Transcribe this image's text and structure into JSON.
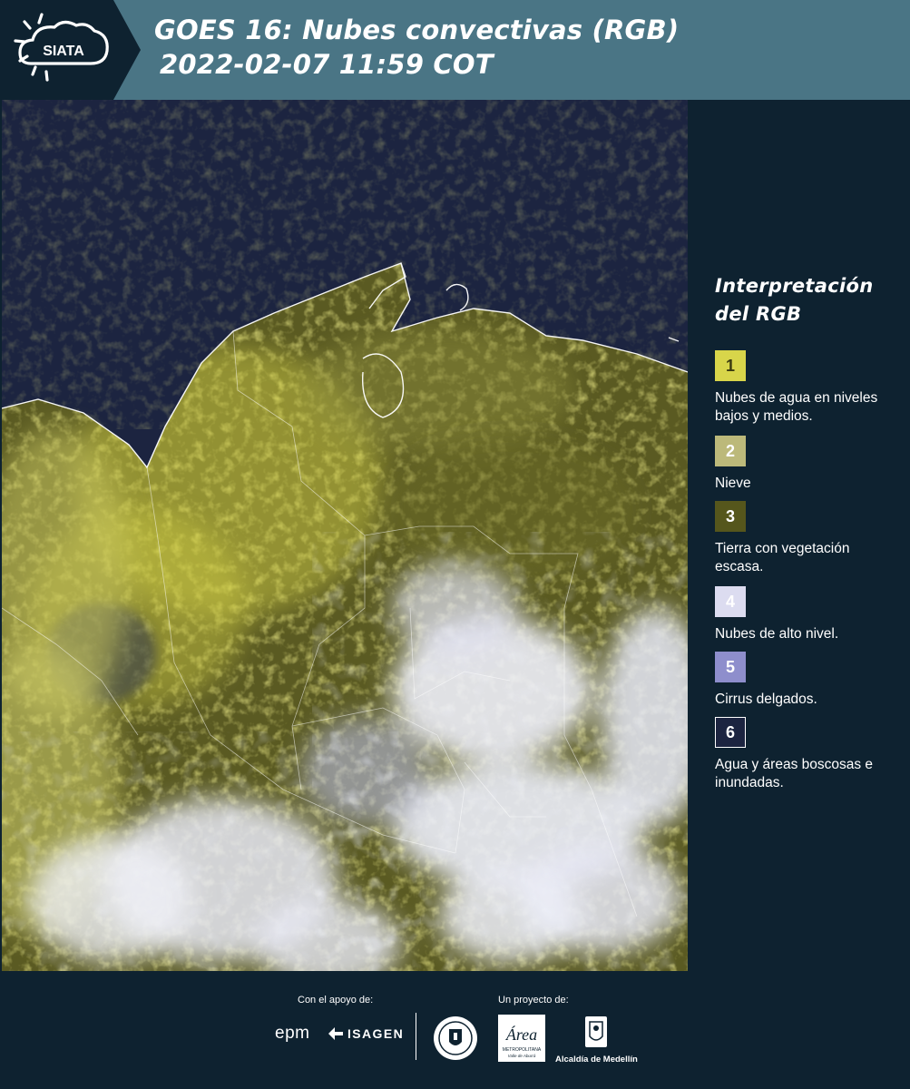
{
  "header": {
    "logo_text": "SIATA",
    "title_line1": "GOES 16: Nubes convectivas (RGB)",
    "title_line2": "2022-02-07 11:59 COT",
    "bg_color": "#4a7585"
  },
  "legend": {
    "title_line1": "Interpretación",
    "title_line2": "del RGB",
    "items": [
      {
        "num": "1",
        "label": "Nubes de agua en niveles bajos y medios.",
        "color": "#d8d54a",
        "text_color": "#3a3a10"
      },
      {
        "num": "2",
        "label": "Nieve",
        "color": "#bcb97a",
        "text_color": "#ffffff"
      },
      {
        "num": "3",
        "label": "Tierra con vegetación escasa.",
        "color": "#55561c",
        "text_color": "#ffffff"
      },
      {
        "num": "4",
        "label": "Nubes de alto nivel.",
        "color": "#dcdcf0",
        "text_color": "#ffffff"
      },
      {
        "num": "5",
        "label": "Cirrus delgados.",
        "color": "#8e8ecc",
        "text_color": "#ffffff"
      },
      {
        "num": "6",
        "label": "Agua y áreas boscosas e inundadas.",
        "color": "#1c2440",
        "text_color": "#ffffff"
      }
    ]
  },
  "footer": {
    "support_label": "Con el apoyo de:",
    "project_label": "Un proyecto de:",
    "sponsors": [
      "epm",
      "ISAGEN"
    ],
    "area_logo_text": "Área",
    "area_logo_sub1": "METROPOLITANA",
    "area_logo_sub2": "Valle de Aburrá",
    "alcaldia_text": "Alcaldía de Medellín",
    "seal_text": "MEDELLÍN"
  },
  "colors": {
    "background": "#0e2230",
    "ocean": "#1c2440",
    "cloud_low": "#d8d54a",
    "cloud_high": "#e6e8f5"
  }
}
